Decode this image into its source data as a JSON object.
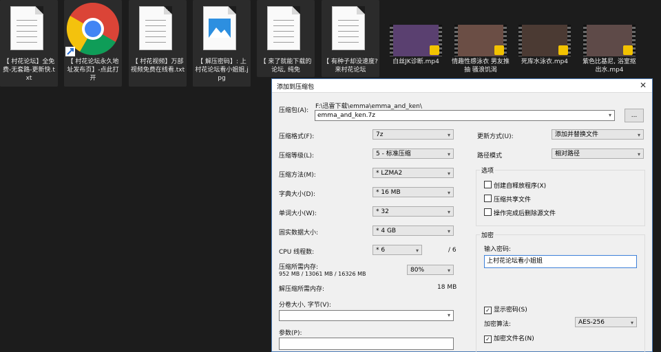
{
  "desktop": {
    "files": [
      {
        "label": "【 村花论坛】全免费-无套路-更新快.txt",
        "type": "txt"
      },
      {
        "label": "【 村花论坛永久地址发布页】-点此打开",
        "type": "chrome"
      },
      {
        "label": "【 村花视频】万部视频免费在线看.txt",
        "type": "txt"
      },
      {
        "label": "【 解压密码】: 上村花论坛看小姐姐.jpg",
        "type": "image"
      },
      {
        "label": "【 来了就能下载的论坛, 纯免",
        "type": "txt"
      },
      {
        "label": "【 有种子却没速度? 来村花论坛",
        "type": "txt"
      }
    ],
    "videos": [
      {
        "label": "白丝JK诊断.mp4"
      },
      {
        "label": "情趣性感泳衣 男友推抽 骚浪饥渴"
      },
      {
        "label": "死库水泳衣.mp4"
      },
      {
        "label": "紫色比基尼, 浴室抠出水.mp4"
      }
    ]
  },
  "dialog": {
    "title": "添加到压缩包",
    "close": "✕",
    "archive_label": "压缩包(A):",
    "archive_path": "F:\\迅雷下载\\emma\\emma_and_ken\\",
    "archive_value": "emma_and_ken.7z",
    "browse": "...",
    "format_label": "压缩格式(F):",
    "format": "7z",
    "level_label": "压缩等级(L):",
    "level": "5 - 标准压缩",
    "method_label": "压缩方法(M):",
    "method": "* LZMA2",
    "dict_label": "字典大小(D):",
    "dict": "* 16 MB",
    "word_label": "单词大小(W):",
    "word": "* 32",
    "solid_label": "固实数据大小:",
    "solid": "* 4 GB",
    "cpu_label": "CPU 线程数:",
    "cpu": "* 6",
    "cpu_max": "/ 6",
    "mem_label": "压缩所需内存:",
    "mem_value": "952 MB / 13061 MB / 16326 MB",
    "mem_pct": "80%",
    "unmem_label": "解压缩所需内存:",
    "unmem_value": "18 MB",
    "split_label": "分卷大小, 字节(V):",
    "params_label": "参数(P):",
    "update_label": "更新方式(U):",
    "update": "添加并替换文件",
    "path_label": "路径模式",
    "path": "相对路径",
    "options_title": "选项",
    "opt_sfx": "创建自释放程序(X)",
    "opt_shared": "压缩共享文件",
    "opt_delete": "操作完成后删除源文件",
    "enc_title": "加密",
    "pw_label": "输入密码:",
    "pw_value": "上村花论坛看小姐姐",
    "show_pw": "显示密码(S)",
    "algo_label": "加密算法:",
    "algo": "AES-256",
    "enc_names": "加密文件名(N)",
    "check": "✓"
  },
  "colors": {
    "desktop_bg": "#1c1c1c",
    "dialog_bg": "#f0f0f0",
    "accent": "#4a7ab5",
    "badge": "#f2c200"
  }
}
